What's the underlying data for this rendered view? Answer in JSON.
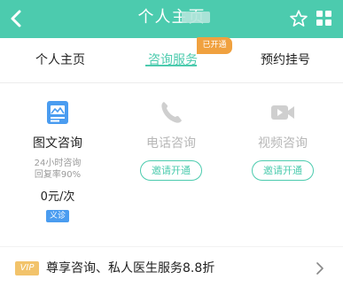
{
  "header": {
    "title": "个人主页",
    "back_icon": "chevron-left-icon",
    "star_icon": "star-outline-icon",
    "grid_icon": "grid-icon",
    "bg_color": "#4ccbae"
  },
  "tabs": [
    {
      "label": "个人主页",
      "active": false
    },
    {
      "label": "咨询服务",
      "active": true
    },
    {
      "label": "预约挂号",
      "active": false
    }
  ],
  "opened_badge": "已开通",
  "services": [
    {
      "icon": "image-text-icon",
      "label": "图文咨询",
      "sub1": "24小时咨询",
      "sub2": "回复率90%",
      "price": "0元/次",
      "tag": "义诊",
      "enabled": true
    },
    {
      "icon": "phone-icon",
      "label": "电话咨询",
      "button": "邀请开通",
      "enabled": false
    },
    {
      "icon": "video-icon",
      "label": "视频咨询",
      "button": "邀请开通",
      "enabled": false
    }
  ],
  "vip": {
    "badge": "VIP",
    "text": "尊享咨询、私人医生服务8.8折",
    "chevron_icon": "chevron-right-icon"
  },
  "colors": {
    "accent": "#4ccbae",
    "badge_orange": "#f0a13f",
    "tag_blue": "#4a9cf0",
    "vip_gold": "#f2c36b"
  }
}
